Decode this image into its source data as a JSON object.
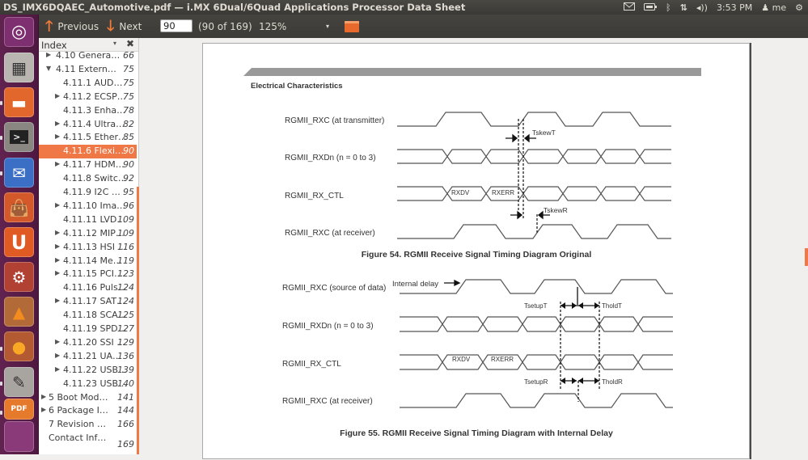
{
  "window": {
    "title": "DS_IMX6DQAEC_Automotive.pdf — i.MX 6Dual/6Quad Applications Processor Data Sheet"
  },
  "tray": {
    "mail_icon": "envelope-icon",
    "battery_icon": "battery-icon",
    "bluetooth_icon": "bluetooth-icon",
    "network_icon": "network-updown-icon",
    "volume_icon": "speaker-icon",
    "clock": "3:53 PM",
    "user": "me",
    "power_icon": "gear-power-icon"
  },
  "launcher": {
    "items": [
      {
        "name": "dash-home",
        "icon": "ubuntu-logo-icon",
        "color": "#7e2f6f"
      },
      {
        "name": "calculator",
        "icon": "calculator-icon",
        "color": "#9e9a96"
      },
      {
        "name": "files",
        "icon": "folder-icon",
        "color": "#e2672c"
      },
      {
        "name": "terminal",
        "icon": "terminal-icon",
        "color": "#7a7773"
      },
      {
        "name": "thunderbird",
        "icon": "mail-client-icon",
        "color": "#3b6fc6"
      },
      {
        "name": "software-center",
        "icon": "shopping-bag-icon",
        "color": "#d3592a"
      },
      {
        "name": "ubuntu-one",
        "icon": "ubuntu-one-icon",
        "color": "#e05a24"
      },
      {
        "name": "system-settings",
        "icon": "settings-wrench-icon",
        "color": "#b04133"
      },
      {
        "name": "vlc",
        "icon": "traffic-cone-icon",
        "color": "#b26a38"
      },
      {
        "name": "firefox",
        "icon": "firefox-icon",
        "color": "#b35a33"
      },
      {
        "name": "text-editor",
        "icon": "text-editor-icon",
        "color": "#a8a4a0"
      },
      {
        "name": "pdf-viewer",
        "icon": "pdf-icon",
        "color": "#e57a2c"
      }
    ]
  },
  "toolbar": {
    "previous_label": "Previous",
    "next_label": "Next",
    "page_value": "90",
    "page_count": "(90 of 169)",
    "zoom": "125%"
  },
  "sidebar": {
    "header": "Index",
    "items": [
      {
        "label": "4.10 Genera…",
        "page": "66",
        "level": 1,
        "expander": "collapsed"
      },
      {
        "label": "4.11 Extern…",
        "page": "75",
        "level": 1,
        "expander": "expanded"
      },
      {
        "label": "4.11.1 AUD…",
        "page": "75",
        "level": 2,
        "expander": "none"
      },
      {
        "label": "4.11.2 ECSP…",
        "page": "75",
        "level": 2,
        "expander": "collapsed"
      },
      {
        "label": "4.11.3 Enha…",
        "page": "78",
        "level": 2,
        "expander": "none"
      },
      {
        "label": "4.11.4 Ultra…",
        "page": "82",
        "level": 2,
        "expander": "collapsed"
      },
      {
        "label": "4.11.5 Ether…",
        "page": "85",
        "level": 2,
        "expander": "collapsed"
      },
      {
        "label": "4.11.6 Flexi…",
        "page": "90",
        "level": 2,
        "expander": "none",
        "selected": true
      },
      {
        "label": "4.11.7 HDM…",
        "page": "90",
        "level": 2,
        "expander": "collapsed"
      },
      {
        "label": "4.11.8 Switc…",
        "page": "92",
        "level": 2,
        "expander": "none"
      },
      {
        "label": "4.11.9 I2C …",
        "page": "95",
        "level": 2,
        "expander": "none"
      },
      {
        "label": "4.11.10 Ima…",
        "page": "96",
        "level": 2,
        "expander": "collapsed"
      },
      {
        "label": "4.11.11 LVD…",
        "page": "109",
        "level": 2,
        "expander": "none"
      },
      {
        "label": "4.11.12 MIP…",
        "page": "109",
        "level": 2,
        "expander": "collapsed"
      },
      {
        "label": "4.11.13 HSI …",
        "page": "116",
        "level": 2,
        "expander": "collapsed"
      },
      {
        "label": "4.11.14 Me…",
        "page": "119",
        "level": 2,
        "expander": "collapsed"
      },
      {
        "label": "4.11.15 PCI…",
        "page": "123",
        "level": 2,
        "expander": "collapsed"
      },
      {
        "label": "4.11.16 Puls…",
        "page": "124",
        "level": 2,
        "expander": "none"
      },
      {
        "label": "4.11.17 SAT…",
        "page": "124",
        "level": 2,
        "expander": "collapsed"
      },
      {
        "label": "4.11.18 SCA…",
        "page": "125",
        "level": 2,
        "expander": "none"
      },
      {
        "label": "4.11.19 SPD…",
        "page": "127",
        "level": 2,
        "expander": "none"
      },
      {
        "label": "4.11.20 SSI …",
        "page": "129",
        "level": 2,
        "expander": "collapsed"
      },
      {
        "label": "4.11.21 UA…",
        "page": "136",
        "level": 2,
        "expander": "collapsed"
      },
      {
        "label": "4.11.22 USB…",
        "page": "139",
        "level": 2,
        "expander": "collapsed"
      },
      {
        "label": "4.11.23 USB…",
        "page": "140",
        "level": 2,
        "expander": "none"
      },
      {
        "label": "5 Boot Mod…",
        "page": "141",
        "level": 0,
        "expander": "collapsed"
      },
      {
        "label": "6 Package I…",
        "page": "144",
        "level": 0,
        "expander": "collapsed"
      },
      {
        "label": "7 Revision …",
        "page": "166",
        "level": 0,
        "expander": "none"
      },
      {
        "label": "Contact Inf…",
        "page": "169",
        "level": 0,
        "expander": "none"
      }
    ]
  },
  "document": {
    "section_header": "Electrical Characteristics",
    "figure54": {
      "caption": "Figure 54. RGMII Receive Signal Timing Diagram Original",
      "signals": [
        {
          "prefix": "RGMII_RXC",
          "suffix": " (at transmitter)"
        },
        {
          "prefix": "RGMII_RXDn",
          "suffix": " (n = 0 to 3)"
        },
        {
          "prefix": "RGMII_RX_CTL",
          "suffix": ""
        },
        {
          "prefix": "RGMII_RXC",
          "suffix": " (at receiver)"
        }
      ],
      "labels": {
        "tskew_t": "TskewT",
        "tskew_r": "TskewR",
        "rxdv": "RXDV",
        "rxerr": "RXERR"
      }
    },
    "figure55": {
      "caption": "Figure 55. RGMII Receive Signal Timing Diagram with Internal Delay",
      "signals": [
        {
          "prefix": "RGMII_RXC",
          "suffix": " (source of data)"
        },
        {
          "prefix": "RGMII_RXDn",
          "suffix": " (n = 0 to 3)"
        },
        {
          "prefix": "RGMII_RX_CTL",
          "suffix": ""
        },
        {
          "prefix": "RGMII_RXC",
          "suffix": " (at receiver)"
        }
      ],
      "labels": {
        "internal_delay": "Internal delay",
        "tsetup_t": "TsetupT",
        "thold_t": "TholdT",
        "tsetup_r": "TsetupR",
        "thold_r": "TholdR",
        "rxdv": "RXDV",
        "rxerr": "RXERR"
      }
    }
  }
}
